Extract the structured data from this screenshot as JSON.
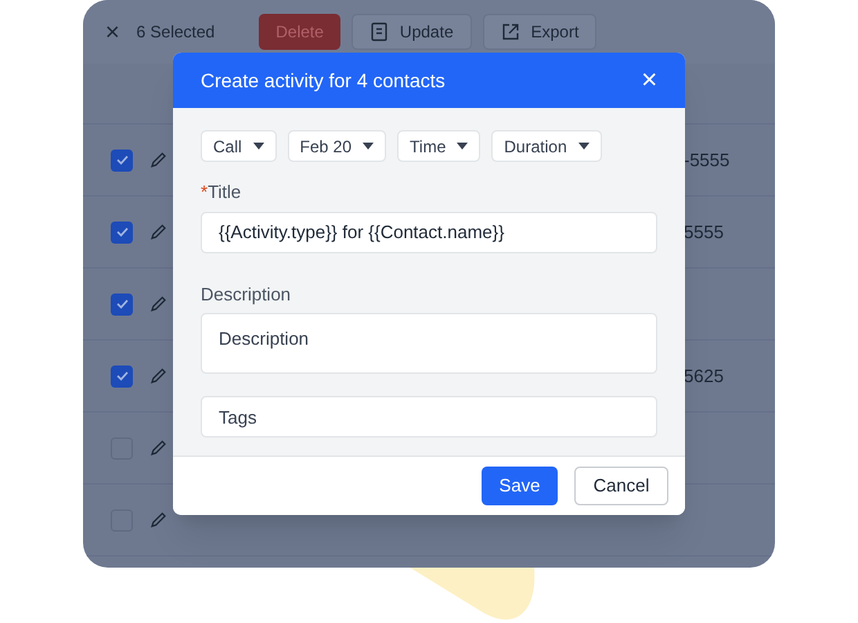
{
  "toolbar": {
    "close": "×",
    "selected_count": "6 Selected",
    "buttons": [
      {
        "kind": "danger",
        "label": "Delete"
      },
      {
        "kind": "update",
        "label": "Update"
      },
      {
        "kind": "export",
        "label": "Export"
      }
    ]
  },
  "rows": [
    {
      "checked": true,
      "phone": "-5555"
    },
    {
      "checked": true,
      "phone": "5555"
    },
    {
      "checked": true,
      "phone": ""
    },
    {
      "checked": true,
      "phone": "5625"
    },
    {
      "checked": false,
      "phone": ""
    },
    {
      "checked": false,
      "phone": ""
    }
  ],
  "dialog": {
    "title": "Create activity for 4 contacts",
    "close": "×",
    "dropdowns": [
      "Call",
      "Feb 20",
      "Time",
      "Duration"
    ],
    "title_field": {
      "required_mark": "*",
      "label": "Title",
      "value": "{{Activity.type}} for {{Contact.name}}"
    },
    "description_field": {
      "label": "Description",
      "placeholder": "Description"
    },
    "tags_field": {
      "placeholder": "Tags"
    },
    "buttons": [
      {
        "kind": "primary",
        "label": "Save"
      },
      {
        "kind": "secondary",
        "label": "Cancel"
      }
    ]
  }
}
